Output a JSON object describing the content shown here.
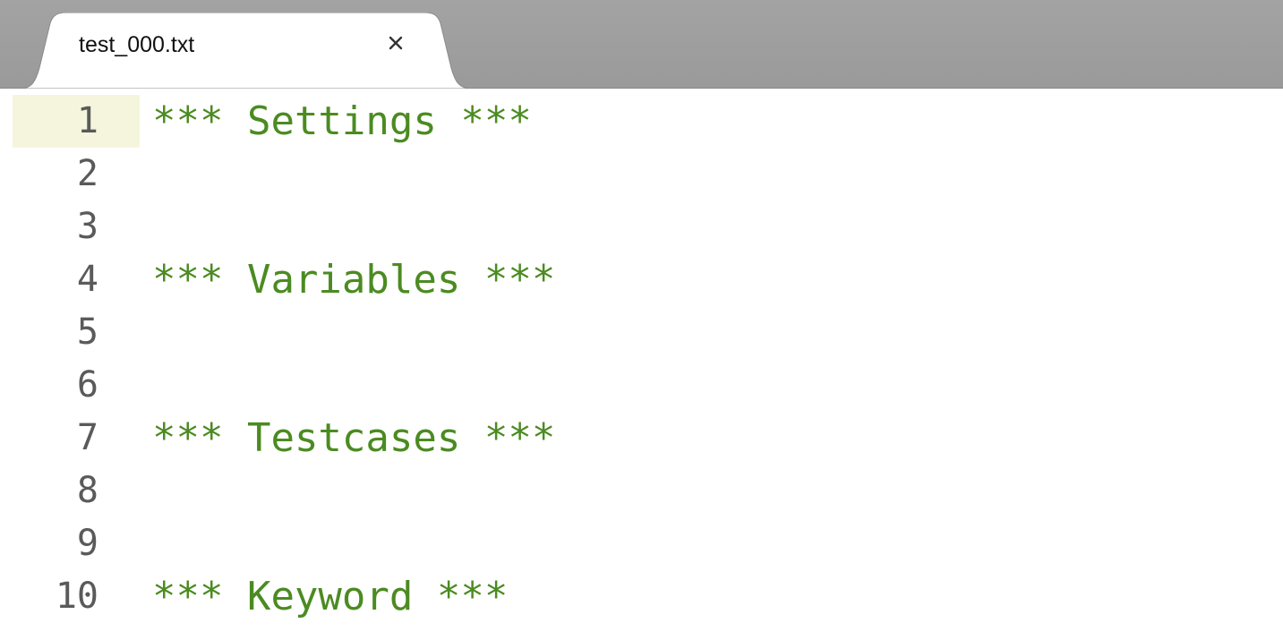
{
  "tab": {
    "title": "test_000.txt",
    "close_glyph": "×",
    "close_icon": "close-icon"
  },
  "colors": {
    "tabbar_bg": "#9e9e9e",
    "code_text": "#4b8b21",
    "line_number": "#5a5a5a",
    "current_line_gutter": "#f4f5dc"
  },
  "editor": {
    "current_line": 1,
    "lines": [
      {
        "number": "1",
        "text": "*** Settings ***"
      },
      {
        "number": "2",
        "text": ""
      },
      {
        "number": "3",
        "text": ""
      },
      {
        "number": "4",
        "text": "*** Variables ***"
      },
      {
        "number": "5",
        "text": ""
      },
      {
        "number": "6",
        "text": ""
      },
      {
        "number": "7",
        "text": "*** Testcases ***"
      },
      {
        "number": "8",
        "text": ""
      },
      {
        "number": "9",
        "text": ""
      },
      {
        "number": "10",
        "text": "*** Keyword ***"
      }
    ]
  }
}
